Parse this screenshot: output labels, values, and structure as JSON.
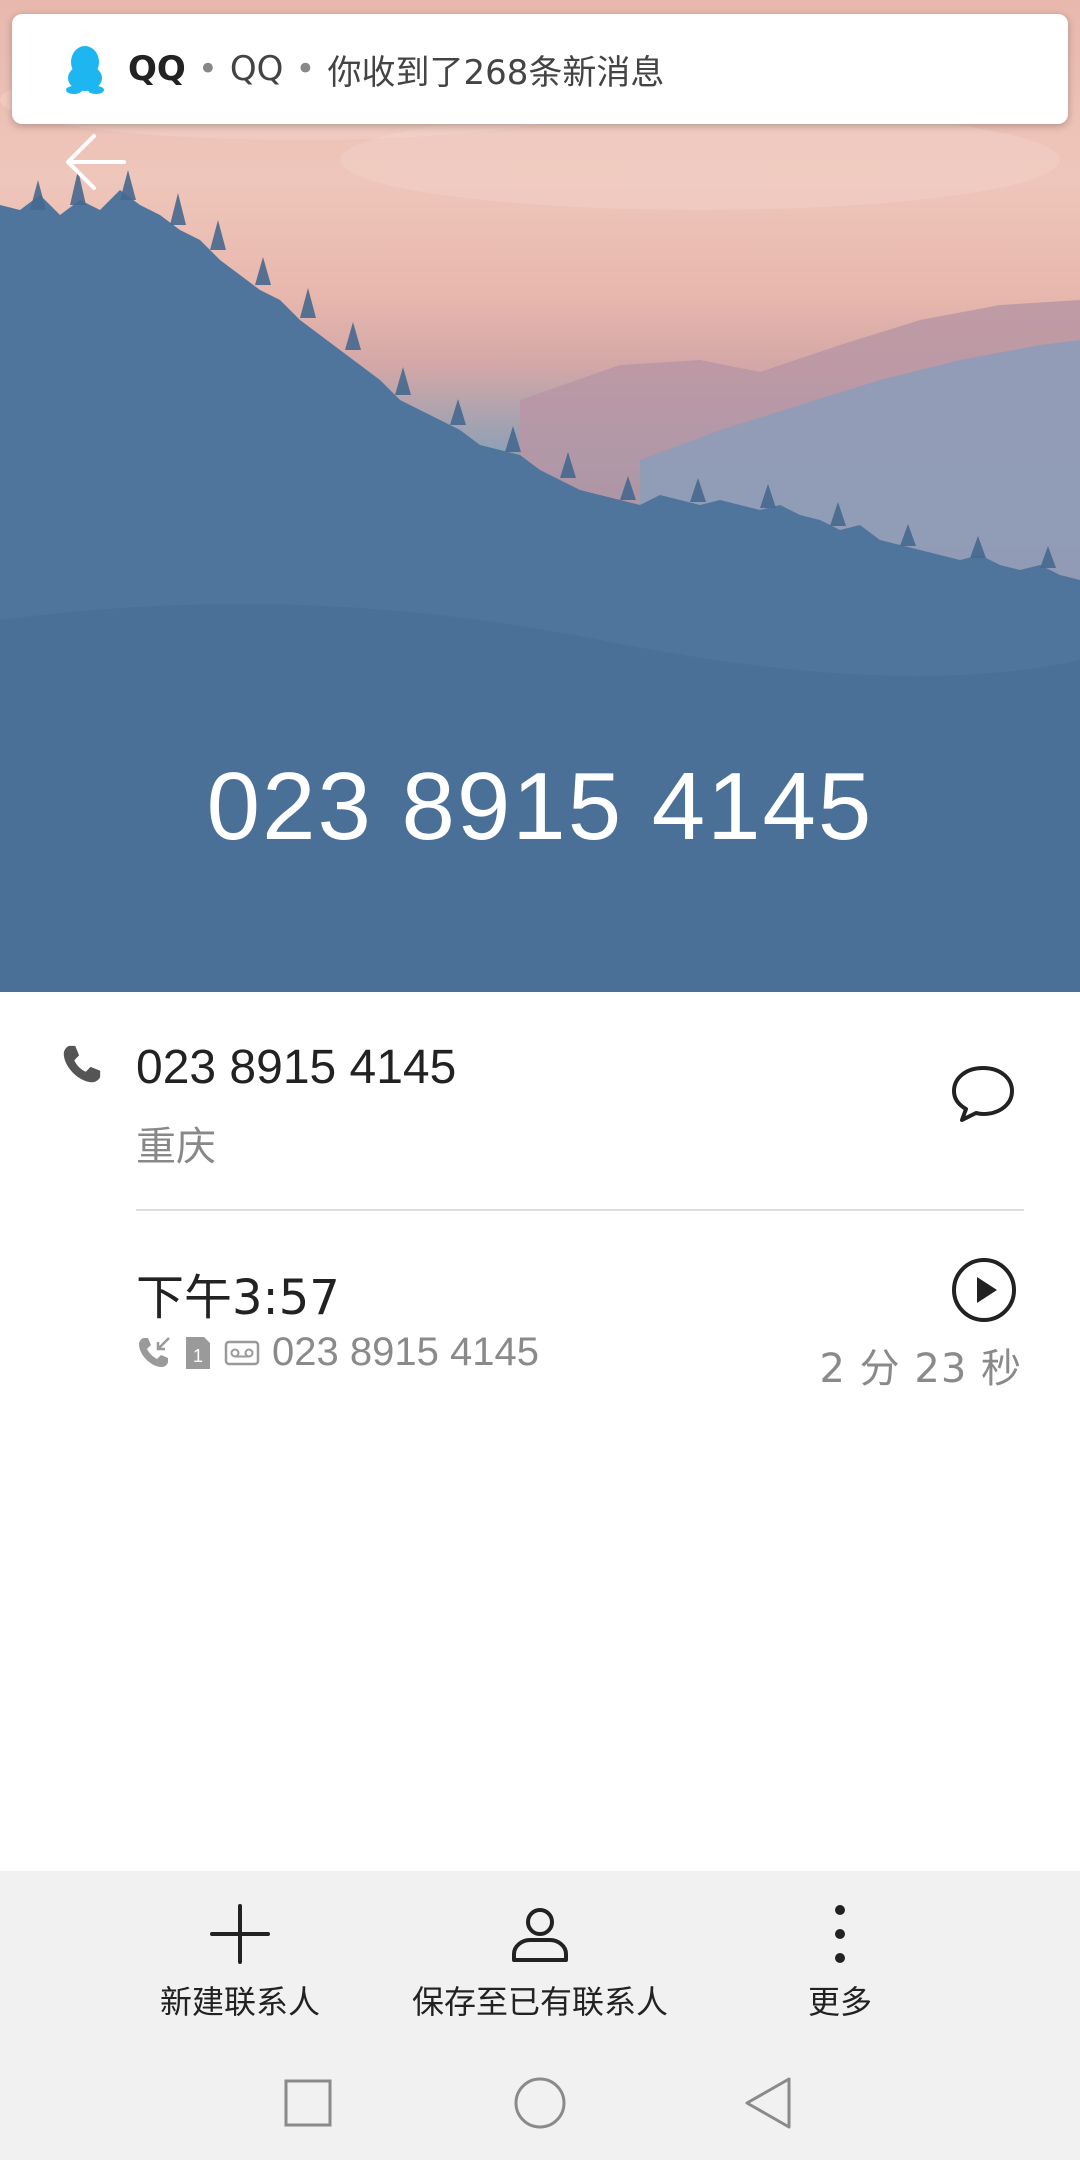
{
  "notification": {
    "app_name": "QQ",
    "separator": "•",
    "sender": "QQ",
    "message": "你收到了268条新消息"
  },
  "header": {
    "number": "023 8915 4145"
  },
  "contact": {
    "number": "023 8915 4145",
    "location": "重庆"
  },
  "call_log": {
    "time": "下午3:57",
    "sim_number": "1",
    "number": "023 8915 4145",
    "duration": "2 分 23 秒"
  },
  "toolbar": {
    "new_contact_label": "新建联系人",
    "save_existing_label": "保存至已有联系人",
    "more_label": "更多"
  },
  "colors": {
    "qq_icon": "#1EB6F1",
    "banner_top": "#EFC6BB",
    "banner_bottom": "#4A6F98",
    "toolbar_bg": "#F1F1F1"
  },
  "icons": {
    "back": "arrow-left-icon",
    "phone": "phone-icon",
    "message": "chat-bubble-icon",
    "play": "play-icon",
    "incoming": "incoming-call-icon",
    "sim": "sim-card-icon",
    "voicemail": "voicemail-icon",
    "new_contact": "plus-icon",
    "save_existing": "person-icon",
    "more": "more-vertical-icon",
    "recents": "square-icon",
    "home": "circle-icon",
    "back_nav": "triangle-back-icon"
  }
}
